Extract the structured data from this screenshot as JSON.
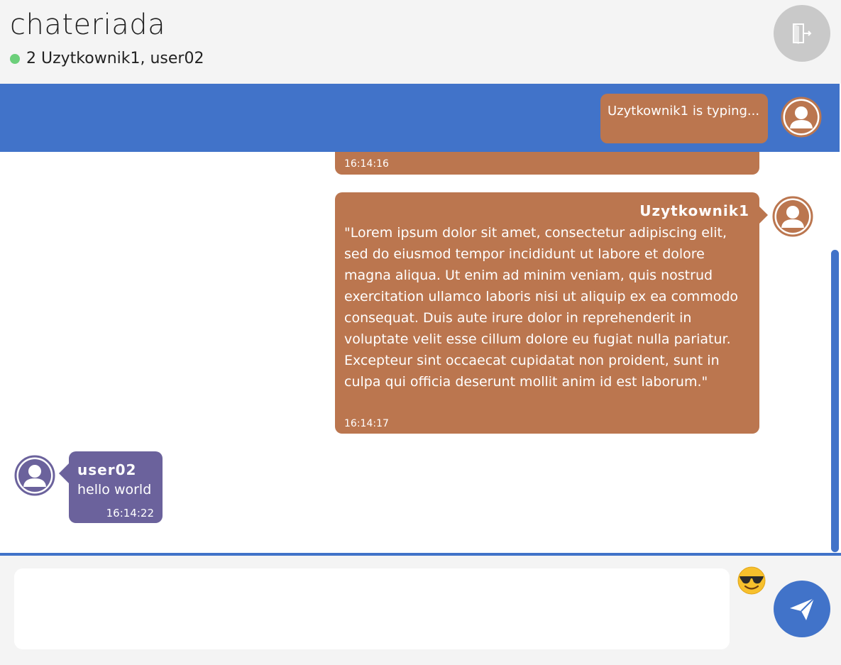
{
  "header": {
    "title": "chateriada",
    "online_text": "2 Uzytkownik1, user02"
  },
  "typing": {
    "text": "Uzytkownik1 is typing..."
  },
  "messages": [
    {
      "time": "16:14:16"
    },
    {
      "sender": "Uzytkownik1",
      "text": "\"Lorem ipsum dolor sit amet, consectetur adipiscing elit, sed do eiusmod tempor incididunt ut labore et dolore magna aliqua. Ut enim ad minim veniam, quis nostrud exercitation ullamco laboris nisi ut aliquip ex ea commodo consequat. Duis aute irure dolor in reprehenderit in voluptate velit esse cillum dolore eu fugiat nulla pariatur. Excepteur sint occaecat cupidatat non proident, sunt in culpa qui officia deserunt mollit anim id est laborum.\"",
      "time": "16:14:17"
    },
    {
      "sender": "user02",
      "text": "hello world",
      "time": "16:14:22"
    }
  ],
  "composer": {
    "value": "",
    "emoji": "😎"
  },
  "colors": {
    "accent": "#4173c9",
    "own_bubble": "#bb764f",
    "other_bubble": "#6b629c",
    "online": "#6ccf7a"
  },
  "icons": {
    "leave": "door-exit-icon",
    "send": "paper-plane-icon",
    "avatar": "user-avatar-icon"
  }
}
